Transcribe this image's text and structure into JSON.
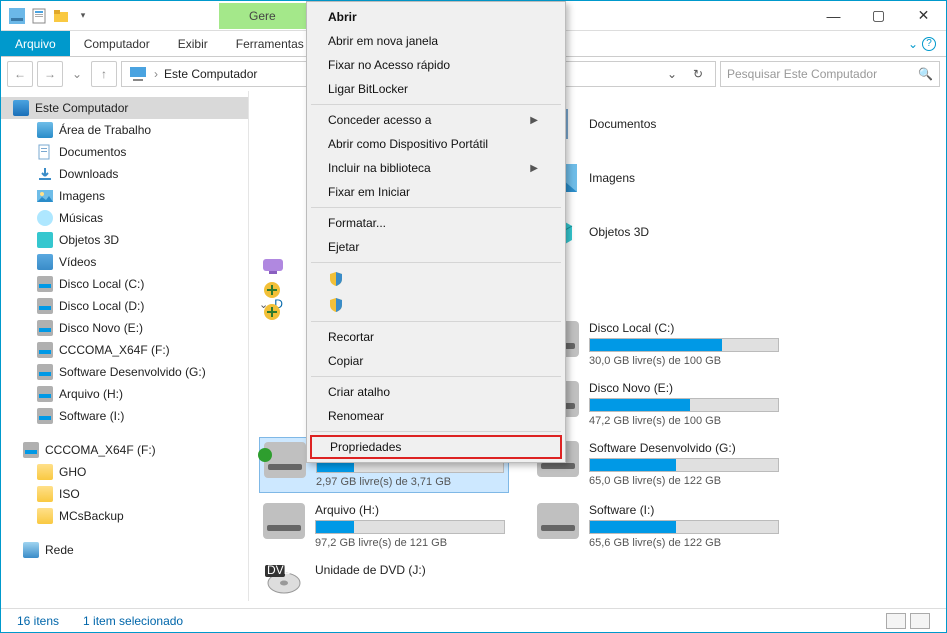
{
  "titlebar": {
    "manage": "Gere"
  },
  "menu": {
    "arquivo": "Arquivo",
    "computador": "Computador",
    "exibir": "Exibir",
    "ferramentas": "Ferramentas"
  },
  "address": {
    "crumb": "Este Computador"
  },
  "search": {
    "placeholder": "Pesquisar Este Computador"
  },
  "tree": {
    "root": "Este Computador",
    "items": [
      "Área de Trabalho",
      "Documentos",
      "Downloads",
      "Imagens",
      "Músicas",
      "Objetos 3D",
      "Vídeos",
      "Disco Local (C:)",
      "Disco Local (D:)",
      "Disco Novo (E:)",
      "CCCOMA_X64F (F:)",
      "Software Desenvolvido (G:)",
      "Arquivo (H:)",
      "Software (I:)"
    ],
    "usb": "CCCOMA_X64F (F:)",
    "usb_children": [
      "GHO",
      "ISO",
      "MCsBackup"
    ],
    "rede": "Rede"
  },
  "content": {
    "cat_devices": "D",
    "folders": [
      "Documentos",
      "Imagens",
      "Objetos 3D"
    ],
    "drives": [
      {
        "name": "Disco Local (C:)",
        "info": "30,0 GB livre(s) de 100 GB",
        "pct": 70
      },
      {
        "name": "Disco Novo (E:)",
        "info": "47,2 GB livre(s) de 100 GB",
        "pct": 53
      },
      {
        "name": "CCCOMA_X64F (F:)",
        "info": "2,97 GB livre(s) de 3,71 GB",
        "pct": 20,
        "selected": true,
        "usb": true
      },
      {
        "name": "Software Desenvolvido (G:)",
        "info": "65,0 GB livre(s) de 122 GB",
        "pct": 46
      },
      {
        "name": "Arquivo (H:)",
        "info": "97,2 GB livre(s) de 121 GB",
        "pct": 20
      },
      {
        "name": "Software (I:)",
        "info": "65,6 GB livre(s) de 122 GB",
        "pct": 46
      },
      {
        "name": "Unidade de DVD (J:)",
        "info": "",
        "pct": 0,
        "nobar": true,
        "dvd": true
      }
    ]
  },
  "ctx": {
    "abrir": "Abrir",
    "nova_janela": "Abrir em nova janela",
    "pin_quick": "Fixar no Acesso rápido",
    "bitlocker": "Ligar BitLocker",
    "conceder": "Conceder acesso a",
    "portatil": "Abrir como Dispositivo Portátil",
    "biblioteca": "Incluir na biblioteca",
    "pin_start": "Fixar em Iniciar",
    "formatar": "Formatar...",
    "ejetar": "Ejetar",
    "recortar": "Recortar",
    "copiar": "Copiar",
    "atalho": "Criar atalho",
    "renomear": "Renomear",
    "propriedades": "Propriedades"
  },
  "status": {
    "count": "16 itens",
    "sel": "1 item selecionado"
  }
}
